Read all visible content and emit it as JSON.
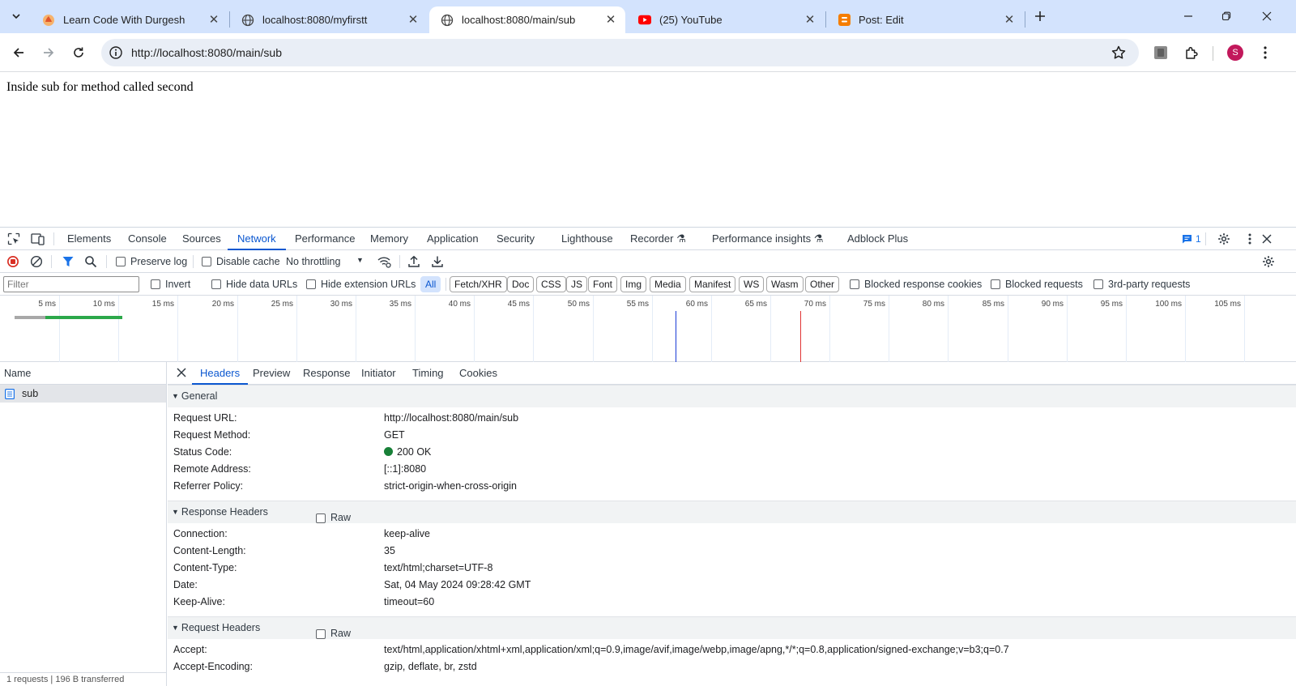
{
  "browser": {
    "tabs": [
      {
        "title": "Learn Code With Durgesh",
        "icon": "durgesh-favicon"
      },
      {
        "title": "localhost:8080/myfirstt",
        "icon": "globe-icon"
      },
      {
        "title": "localhost:8080/main/sub",
        "icon": "globe-icon",
        "active": true
      },
      {
        "title": "(25) YouTube",
        "icon": "youtube-icon"
      },
      {
        "title": "Post: Edit",
        "icon": "blogger-icon"
      }
    ],
    "url": "http://localhost:8080/main/sub",
    "profile_initial": "S",
    "profile_color": "#c2185b"
  },
  "page": {
    "body_text": "Inside sub for method called second"
  },
  "devtools": {
    "tabs": [
      "Elements",
      "Console",
      "Sources",
      "Network",
      "Performance",
      "Memory",
      "Application",
      "Security",
      "Lighthouse",
      "Recorder",
      "Performance insights",
      "Adblock Plus"
    ],
    "active_tab": "Network",
    "issues_count": "1",
    "toolbar": {
      "preserve_log": "Preserve log",
      "disable_cache": "Disable cache",
      "throttling": "No throttling"
    },
    "filter": {
      "placeholder": "Filter",
      "invert": "Invert",
      "hide_data_urls": "Hide data URLs",
      "hide_extension_urls": "Hide extension URLs",
      "types": [
        "All",
        "Fetch/XHR",
        "Doc",
        "CSS",
        "JS",
        "Font",
        "Img",
        "Media",
        "Manifest",
        "WS",
        "Wasm",
        "Other"
      ],
      "active_type": "All",
      "blocked_response_cookies": "Blocked response cookies",
      "blocked_requests": "Blocked requests",
      "third_party": "3rd-party requests"
    },
    "overview": {
      "ticks": [
        "5 ms",
        "10 ms",
        "15 ms",
        "20 ms",
        "25 ms",
        "30 ms",
        "35 ms",
        "40 ms",
        "45 ms",
        "50 ms",
        "55 ms",
        "60 ms",
        "65 ms",
        "70 ms",
        "75 ms",
        "80 ms",
        "85 ms",
        "90 ms",
        "95 ms",
        "100 ms",
        "105 ms"
      ],
      "dom_content_loaded_ms": 57,
      "load_ms": 67.5,
      "request_start_ms": 1.2,
      "request_wait_end_ms": 3.8,
      "request_end_ms": 10.3,
      "colors": {
        "waiting": "#a8a8a8",
        "download": "#2ca84a",
        "dcl": "#1a3bd6",
        "load": "#e03535"
      }
    },
    "requests": {
      "header": "Name",
      "items": [
        {
          "name": "sub"
        }
      ],
      "summary": "1 requests | 196 B transferred"
    },
    "detail": {
      "tabs": [
        "Headers",
        "Preview",
        "Response",
        "Initiator",
        "Timing",
        "Cookies"
      ],
      "active_tab": "Headers",
      "general": {
        "title": "General",
        "rows": [
          {
            "key": "Request URL:",
            "value": "http://localhost:8080/main/sub"
          },
          {
            "key": "Request Method:",
            "value": "GET"
          },
          {
            "key": "Status Code:",
            "value": "200 OK"
          },
          {
            "key": "Remote Address:",
            "value": "[::1]:8080"
          },
          {
            "key": "Referrer Policy:",
            "value": "strict-origin-when-cross-origin"
          }
        ]
      },
      "response_headers": {
        "title": "Response Headers",
        "raw": "Raw",
        "rows": [
          {
            "key": "Connection:",
            "value": "keep-alive"
          },
          {
            "key": "Content-Length:",
            "value": "35"
          },
          {
            "key": "Content-Type:",
            "value": "text/html;charset=UTF-8"
          },
          {
            "key": "Date:",
            "value": "Sat, 04 May 2024 09:28:42 GMT"
          },
          {
            "key": "Keep-Alive:",
            "value": "timeout=60"
          }
        ]
      },
      "request_headers": {
        "title": "Request Headers",
        "raw": "Raw",
        "rows": [
          {
            "key": "Accept:",
            "value": "text/html,application/xhtml+xml,application/xml;q=0.9,image/avif,image/webp,image/apng,*/*;q=0.8,application/signed-exchange;v=b3;q=0.7"
          },
          {
            "key": "Accept-Encoding:",
            "value": "gzip, deflate, br, zstd"
          }
        ]
      }
    }
  }
}
